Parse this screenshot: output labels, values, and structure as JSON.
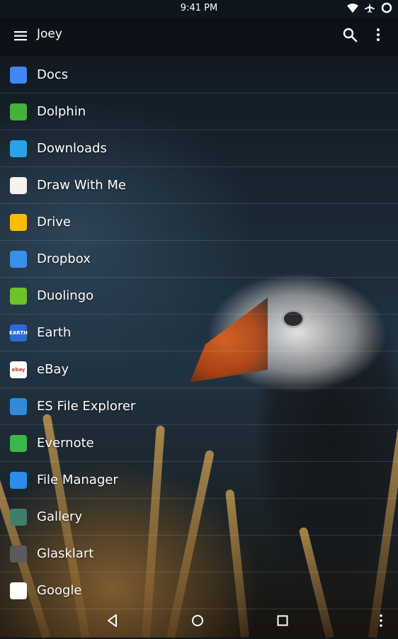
{
  "status_bar": {
    "time": "9:41 PM"
  },
  "app_bar": {
    "title": "Joey"
  },
  "apps": [
    {
      "label": "Docs",
      "icon": "docs-icon",
      "color": "#4285f4"
    },
    {
      "label": "Dolphin",
      "icon": "dolphin-icon",
      "color": "#46b23b"
    },
    {
      "label": "Downloads",
      "icon": "downloads-icon",
      "color": "#29a3e8"
    },
    {
      "label": "Draw With Me",
      "icon": "draw-icon",
      "color": "#f2f2f2"
    },
    {
      "label": "Drive",
      "icon": "drive-icon",
      "color": "#fbbc05"
    },
    {
      "label": "Dropbox",
      "icon": "dropbox-icon",
      "color": "#3a8fe6"
    },
    {
      "label": "Duolingo",
      "icon": "duolingo-icon",
      "color": "#6ec22a"
    },
    {
      "label": "Earth",
      "icon": "earth-icon",
      "color": "#2b6bd6",
      "icon_text": "EARTH"
    },
    {
      "label": "eBay",
      "icon": "ebay-icon",
      "color": "#ffffff",
      "icon_text": "ebay"
    },
    {
      "label": "ES File Explorer",
      "icon": "es-file-explorer-icon",
      "color": "#2f8ad8"
    },
    {
      "label": "Evernote",
      "icon": "evernote-icon",
      "color": "#3db54a"
    },
    {
      "label": "File Manager",
      "icon": "file-manager-icon",
      "color": "#2c8ee8"
    },
    {
      "label": "Gallery",
      "icon": "gallery-icon",
      "color": "#3f7f6a"
    },
    {
      "label": "Glasklart",
      "icon": "glasklart-icon",
      "color": "#5a5a5a"
    },
    {
      "label": "Google",
      "icon": "google-icon",
      "color": "#ffffff"
    }
  ]
}
